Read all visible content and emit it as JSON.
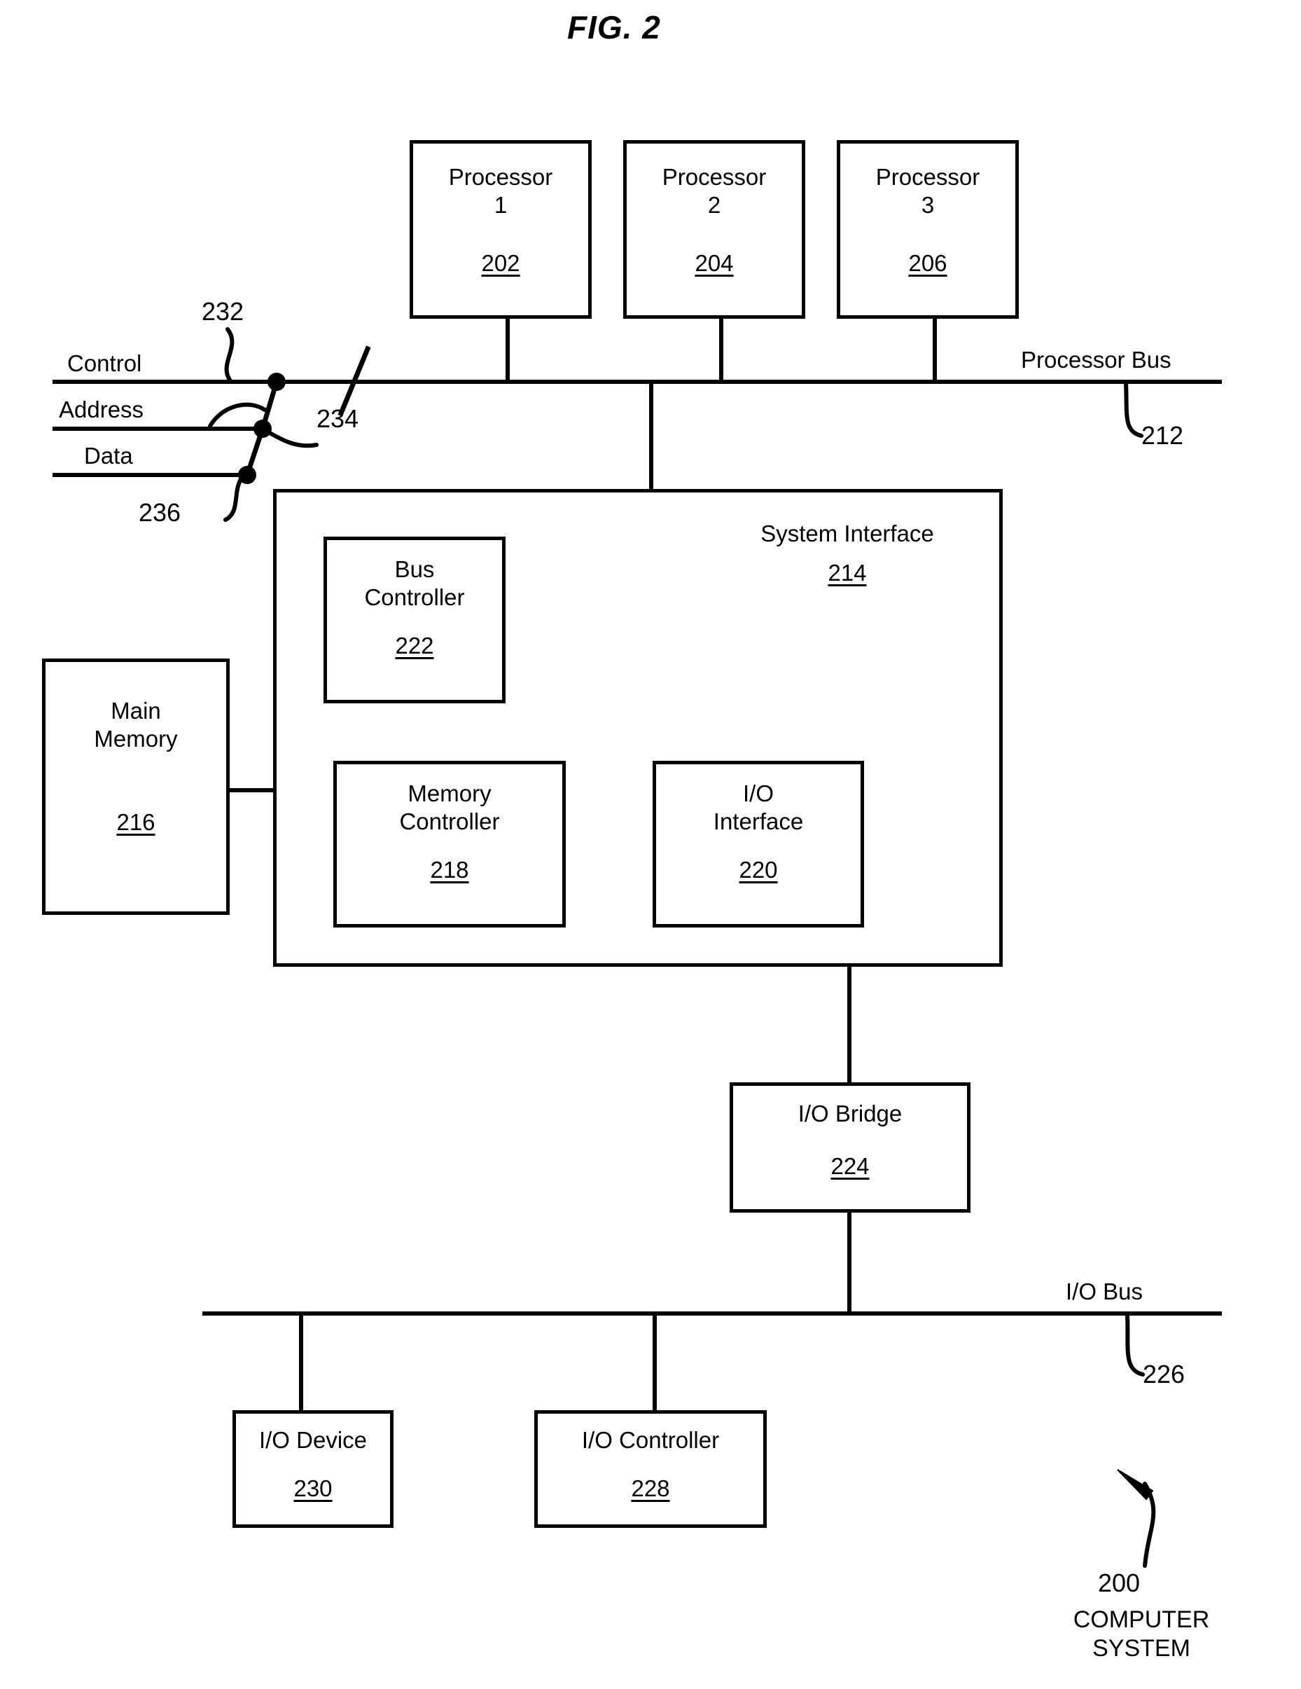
{
  "figure": {
    "title": "FIG. 2",
    "caption_ref": "200",
    "caption_text": "COMPUTER\nSYSTEM"
  },
  "processors": [
    {
      "name": "Processor\n1",
      "ref": "202"
    },
    {
      "name": "Processor\n2",
      "ref": "204"
    },
    {
      "name": "Processor\n3",
      "ref": "206"
    }
  ],
  "bus_lines": {
    "control_label": "Control",
    "address_label": "Address",
    "data_label": "Data",
    "control_ref": "232",
    "address_ref": "234",
    "data_ref": "236"
  },
  "processor_bus": {
    "label": "Processor Bus",
    "ref": "212"
  },
  "system_interface": {
    "title": "System Interface",
    "ref": "214",
    "children": [
      {
        "name": "Bus\nController",
        "ref": "222"
      },
      {
        "name": "Memory\nController",
        "ref": "218"
      },
      {
        "name": "I/O\nInterface",
        "ref": "220"
      }
    ]
  },
  "main_memory": {
    "name": "Main\nMemory",
    "ref": "216"
  },
  "io_bridge": {
    "name": "I/O Bridge",
    "ref": "224"
  },
  "io_bus": {
    "label": "I/O Bus",
    "ref": "226"
  },
  "io_devices": [
    {
      "name": "I/O Device",
      "ref": "230"
    },
    {
      "name": "I/O Controller",
      "ref": "228"
    }
  ]
}
